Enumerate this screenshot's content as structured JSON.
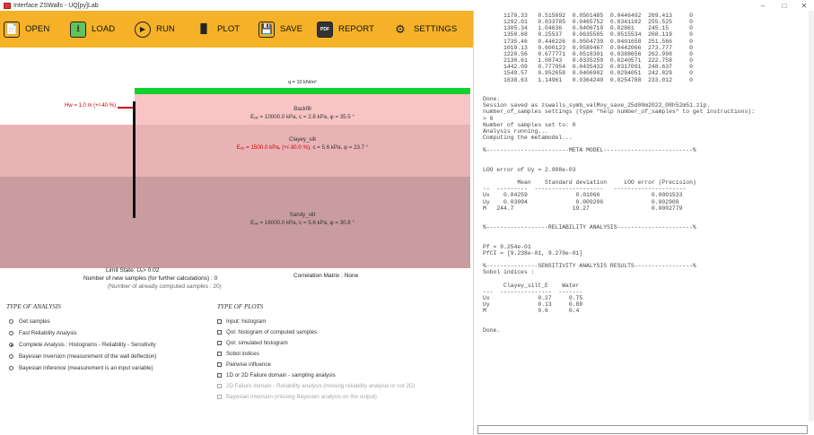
{
  "window": {
    "title": "Interface ZSWalls - UQ[py]Lab",
    "controls": [
      "–",
      "□",
      "✕"
    ]
  },
  "toolbar": {
    "buttons": [
      {
        "label": "OPEN",
        "icon": "📄"
      },
      {
        "label": "LOAD",
        "icon": "⭳"
      },
      {
        "label": "RUN",
        "icon": "▶"
      },
      {
        "label": "PLOT",
        "icon": "▐▌"
      },
      {
        "label": "SAVE",
        "icon": "💾"
      },
      {
        "label": "REPORT",
        "icon": "PDF"
      },
      {
        "label": "SETTINGS",
        "icon": "⚙"
      }
    ]
  },
  "diagram": {
    "surcharge": "q = 10 kN/m²",
    "water_level": "Hw = 1.0 m (+/-40 %)",
    "layers": [
      {
        "name": "Backfill",
        "props": "Eₒₑ = 10000.0 kPa,  c = 2.8 kPa,  φ = 35.5 °",
        "red": "",
        "color": "#f8c4c4"
      },
      {
        "name": "Clayey_silt",
        "props": ", c = 5.6 kPa,  φ = 23.7 °",
        "red": "Eₒₑ = 1500.0 kPa,  (+/-30.0 %)",
        "color": "#e9b3b5"
      },
      {
        "name": "Sandy_silt",
        "props": "Eₒₑ = 16000.0 kPa,  c = 5.6 kPa,  φ = 30.8 °",
        "red": "",
        "color": "#c99c9f"
      }
    ]
  },
  "info": {
    "limit_state": "Limit State:  Uₓ> 0.02",
    "new_samples": "Number of new samples (for further calculations) : 0",
    "computed_samples": "(Number of already computed samples : 20)",
    "correlation": "Correlation Matrix : None"
  },
  "analysis": {
    "title": "TYPE OF ANALYSIS",
    "options": [
      {
        "label": "Get samples",
        "selected": false
      },
      {
        "label": "Fast Reliability Analysis",
        "selected": false
      },
      {
        "label": "Complete Analysis : Histograms - Reliability - Sensitivity",
        "selected": true
      },
      {
        "label": "Bayesian inversion (measurement of the wall deflection)",
        "selected": false
      },
      {
        "label": "Bayesian inference (measurement is an input variable)",
        "selected": false
      }
    ]
  },
  "plots": {
    "title": "TYPE OF PLOTS",
    "options": [
      {
        "label": "Input: histogram",
        "disabled": false
      },
      {
        "label": "QoI: histogram of computed samples",
        "disabled": false
      },
      {
        "label": "QoI: simulated histogram",
        "disabled": false
      },
      {
        "label": "Sobol indices",
        "disabled": false
      },
      {
        "label": "Pairwise influence",
        "disabled": false
      },
      {
        "label": "1D or 2D Failure domain - sampling analysis",
        "disabled": false
      },
      {
        "label": "2D Failure domain - Reliability analysis (missing reliability analysis or not 2D)",
        "disabled": true
      },
      {
        "label": "Bayesian inversion (missing Bayesian analysis on the output)",
        "disabled": true
      }
    ]
  },
  "console": {
    "text": "      1170.33   0.515092  0.0501485  0.0446492  269.413     0\n      1292.01   0.833785  0.0465752  0.0341102  255.525     0\n      1305.34   1.04636   0.0406719  0.02861    245.15      0\n      1350.68   0.25537   0.0635585  0.0515534  268.119     0\n      1735.46   0.446226  0.0504739  0.0401658  251.566     0\n      1019.13   0.600123  0.0589467  0.0442066  273.777     0\n      1220.56   0.677771  0.0518301  0.0388656  262.998     0\n      2130.61   1.08743   0.0335259  0.0240571  222.758     0\n      1442.09   0.777954  0.0435432  0.0317091  248.637     0\n      1549.57   0.952658  0.0406902  0.0294051  242.829     0\n      1638.63   1.14961   0.0364249  0.0254788  233.012     0\n\n\nDone.\nSession saved as zswalls_symb_valMoy_save_25d00m2022_08h52m51.zip.\nnumber_of_samples settings (type \"help number_of_samples\" to get instructions):\n> 0\nNumber of samples set to: 0\nAnalysis running...\nComputing the metamodel...\n\n%------------------------META MODEL--------------------------%\n\n\nLOO error of Uy = 2.908e-03\n\n          Mean    Standard deviation     LOO error (Precision)\n--  ---------  --------------------   ---------------------\nUx    0.04259              0.01066               0.0001533\nUy    0.03094              0.009206              0.002908\nM   244.7                 19.27                  0.0002779\n\n\n%------------------RELIABILITY ANALYSIS----------------------%\n\n\nPf = 9.254e-01\nPfCI = [9.238e-01, 9.270e-01]\n\n%---------------SENSITIVITY ANALYSIS RESULTS-----------------%\nSobol indices :\n\n      Clayey_silt_E    Water\n---  ---------------  -------\nUx              0.27     0.75\nUy              0.13     0.88\nM               0.6      0.4\n\n\nDone."
  }
}
